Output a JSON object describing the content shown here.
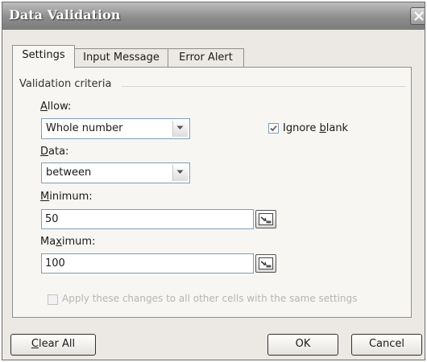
{
  "dialog": {
    "title": "Data Validation"
  },
  "tabs": [
    {
      "label": "Settings",
      "active": true
    },
    {
      "label": "Input Message",
      "active": false
    },
    {
      "label": "Error Alert",
      "active": false
    }
  ],
  "settings": {
    "group_label": "Validation criteria",
    "allow": {
      "label_u": "A",
      "label_rest": "llow:",
      "value": "Whole number"
    },
    "ignore_blank": {
      "label_pre": "Ignore ",
      "label_u": "b",
      "label_rest": "lank",
      "checked": true
    },
    "data": {
      "label_u": "D",
      "label_rest": "ata:",
      "value": "between"
    },
    "minimum": {
      "label_u": "M",
      "label_rest": "inimum:",
      "value": "50"
    },
    "maximum": {
      "label_pre": "Ma",
      "label_u": "x",
      "label_rest": "imum:",
      "value": "100"
    },
    "apply_all": {
      "label": "Apply these changes to all other cells with the same settings",
      "checked": false,
      "enabled": false
    }
  },
  "buttons": {
    "clear_all": {
      "u": "C",
      "rest": "lear All"
    },
    "ok": "OK",
    "cancel": "Cancel"
  }
}
